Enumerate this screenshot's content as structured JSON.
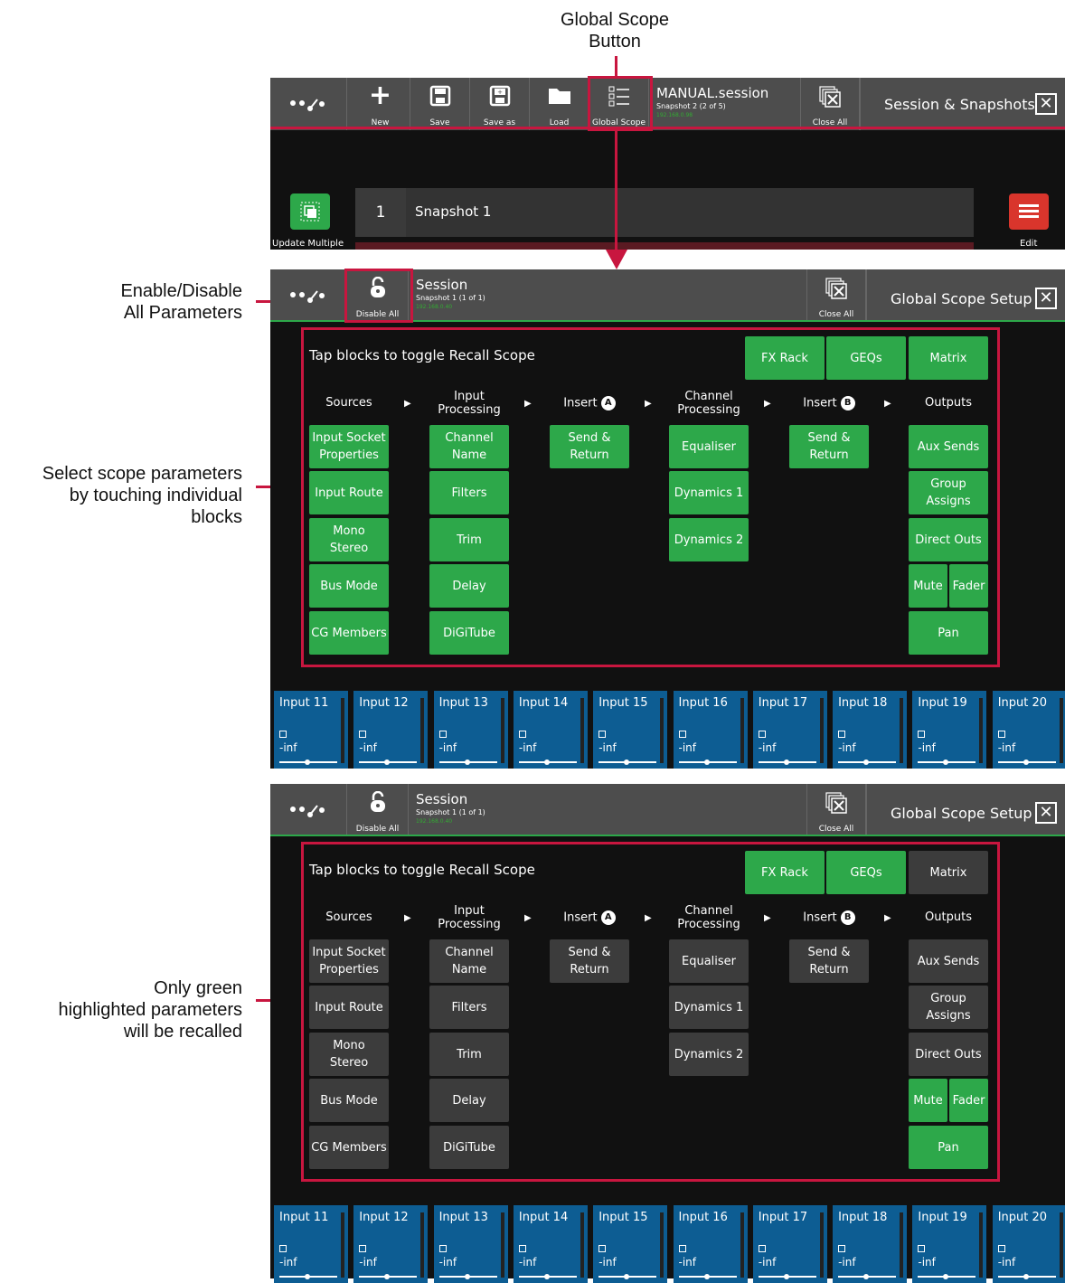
{
  "callouts": {
    "global_scope": "Global Scope\nButton",
    "enable_disable": "Enable/Disable\nAll Parameters",
    "select_scope": "Select scope parameters\nby touching individual\nblocks",
    "only_green": "Only green\nhighlighted parameters\nwill be recalled"
  },
  "session_screen": {
    "buttons": [
      "New",
      "Save",
      "Save as",
      "Load",
      "Global Scope"
    ],
    "title": "MANUAL.session",
    "subtitle": "Snapshot 2 (2 of 5)",
    "ip": "192.168.0.98",
    "close_all": "Close All",
    "panel": "Session & Snapshots",
    "update_multiple": "Update Multiple",
    "snapshot_num": "1",
    "snapshot_name": "Snapshot 1",
    "edit": "Edit"
  },
  "scope_screen": {
    "disable_all": "Disable All",
    "title": "Session",
    "subtitle": "Snapshot 1 (1 of 1)",
    "ip": "192.168.0.40",
    "close_all": "Close All",
    "panel": "Global Scope Setup",
    "instruction": "Tap blocks to toggle Recall Scope",
    "top_buttons": [
      "FX Rack",
      "GEQs",
      "Matrix"
    ],
    "headers": [
      "Sources",
      "Input\nProcessing",
      "Insert",
      "Channel\nProcessing",
      "Insert",
      "Outputs"
    ],
    "insert_badges": [
      "A",
      "B"
    ],
    "sources": [
      "Input Socket\nProperties",
      "Input Route",
      "Mono\nStereo",
      "Bus Mode",
      "CG Members"
    ],
    "input_processing": [
      "Channel\nName",
      "Filters",
      "Trim",
      "Delay",
      "DiGiTube"
    ],
    "insert_a": [
      "Send &\nReturn"
    ],
    "channel_processing": [
      "Equaliser",
      "Dynamics 1",
      "Dynamics 2"
    ],
    "insert_b": [
      "Send &\nReturn"
    ],
    "outputs": [
      "Aux Sends",
      "Group\nAssigns",
      "Direct Outs",
      "Mute",
      "Fader",
      "Pan"
    ]
  },
  "strips": [
    "Input 11",
    "Input 12",
    "Input 13",
    "Input 14",
    "Input 15",
    "Input 16",
    "Input 17",
    "Input 18",
    "Input 19",
    "Input 20"
  ],
  "strip_value": "-inf",
  "colors": {
    "active": "#2da84a",
    "inactive": "#3c3c3c",
    "callout_red": "#c8163f",
    "strip_blue": "#0d5d93"
  },
  "scope_states": {
    "screen2": {
      "top": [
        true,
        true,
        true
      ],
      "all_on": true
    },
    "screen3": {
      "top": [
        true,
        true,
        false
      ],
      "mute": true,
      "fader": true,
      "pan": true,
      "others": false
    }
  }
}
